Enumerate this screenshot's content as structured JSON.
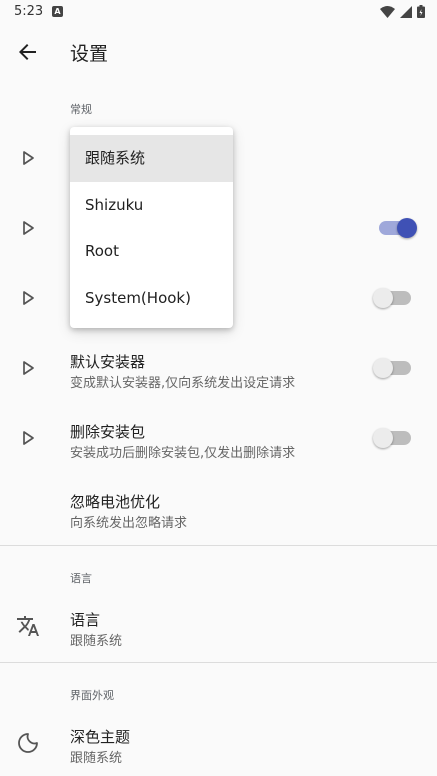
{
  "status_bar": {
    "time": "5:23",
    "notif_glyph": "A"
  },
  "app_bar": {
    "title": "设置"
  },
  "sections": {
    "general": {
      "header": "常规"
    },
    "language": {
      "header": "语言"
    },
    "appearance": {
      "header": "界面外观"
    }
  },
  "rows": {
    "default_installer": {
      "title": "默认安装器",
      "subtitle": "变成默认安装器,仅向系统发出设定请求",
      "switch_on": false
    },
    "delete_package": {
      "title": "删除安装包",
      "subtitle": "安装成功后删除安装包,仅发出删除请求",
      "switch_on": false
    },
    "battery": {
      "title": "忽略电池优化",
      "subtitle": "向系统发出忽略请求"
    },
    "language": {
      "title": "语言",
      "subtitle": "跟随系统"
    },
    "dark_theme": {
      "title": "深色主题",
      "subtitle": "跟随系统"
    }
  },
  "hidden_rows_switches": {
    "row2_on": true,
    "row3_on": false
  },
  "popup_menu": {
    "items": [
      "跟随系统",
      "Shizuku",
      "Root",
      "System(Hook)"
    ],
    "selected_index": 0
  },
  "colors": {
    "accent": "#3f51b5",
    "accent_track": "#9fa8da"
  },
  "icons": {
    "back": "arrow-left-icon",
    "expand": "play-outline-icon",
    "translate": "translate-icon",
    "dark_mode": "moon-icon"
  }
}
